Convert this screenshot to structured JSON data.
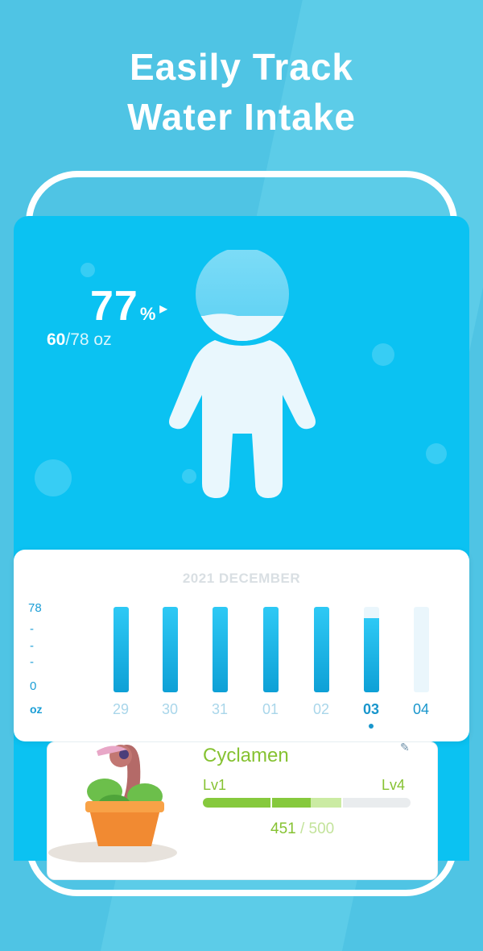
{
  "headline": {
    "line1": "Easily Track",
    "line2": "Water Intake"
  },
  "progress": {
    "percent_value": "77",
    "percent_symbol": "%",
    "consumed": "60",
    "goal": "/78 oz",
    "fraction": 0.77
  },
  "calendar": {
    "month_label": "2021 DECEMBER",
    "y_labels": [
      "78",
      "-",
      "-",
      "-",
      "0",
      "oz"
    ],
    "days": [
      {
        "label": "29",
        "fill": 1.0
      },
      {
        "label": "30",
        "fill": 1.0
      },
      {
        "label": "31",
        "fill": 1.0
      },
      {
        "label": "01",
        "fill": 1.0
      },
      {
        "label": "02",
        "fill": 1.0
      },
      {
        "label": "03",
        "fill": 0.87
      },
      {
        "label": "04",
        "fill": 0.0
      }
    ]
  },
  "plant": {
    "name": "Cyclamen",
    "level_from": "Lv1",
    "level_to": "Lv4",
    "xp_current": "451",
    "xp_total": "/ 500",
    "xp_fraction": 0.52
  },
  "colors": {
    "background": "#4fc4e4",
    "screen": "#0bc2f2",
    "accent_green": "#86c232",
    "bar_blue": "#0ea0d6"
  }
}
